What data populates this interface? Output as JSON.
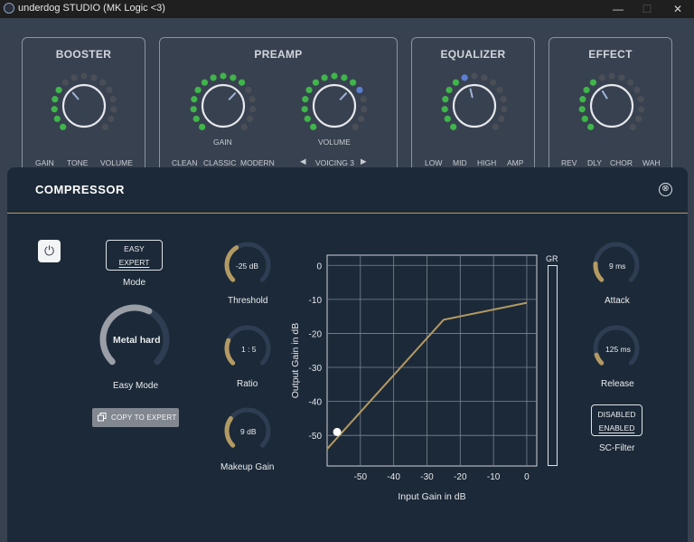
{
  "window": {
    "title": "underdog STUDIO (MK Logic <3)",
    "controls": {
      "minimize": "—",
      "maximize": "☐",
      "close": "✕"
    }
  },
  "modules": {
    "booster": {
      "title": "BOOSTER",
      "options": [
        "GAIN",
        "TONE",
        "VOLUME"
      ],
      "knob_level": 0.35
    },
    "preamp": {
      "title": "PREAMP",
      "channels": [
        "CLEAN",
        "CLASSIC",
        "MODERN"
      ],
      "gain_label": "GAIN",
      "volume_label": "VOLUME",
      "voicing": "VOICING 3",
      "voicing_prev": "◀",
      "voicing_next": "▶",
      "gain_level": 0.66,
      "volume_level": 0.66
    },
    "equalizer": {
      "title": "EQUALIZER",
      "options": [
        "LOW",
        "MID",
        "HIGH",
        "AMP"
      ],
      "knob_level": 0.45
    },
    "effect": {
      "title": "EFFECT",
      "options": [
        "REV",
        "DLY",
        "CHOR",
        "WAH"
      ],
      "knob_level": 0.38
    }
  },
  "compressor": {
    "title": "COMPRESSOR",
    "close_icon": "⊗",
    "power_icon": "⏻",
    "mode": {
      "options": [
        "EASY",
        "EXPERT"
      ],
      "selected": "EXPERT",
      "label": "Mode"
    },
    "easy_mode": {
      "value": "Metal hard",
      "label": "Easy Mode",
      "level": 0.6
    },
    "copy_button": "COPY TO EXPERT",
    "threshold": {
      "value": "-25 dB",
      "label": "Threshold",
      "level": 0.38
    },
    "ratio": {
      "value": "1 : 5",
      "label": "Ratio",
      "level": 0.25
    },
    "makeup_gain": {
      "value": "9 dB",
      "label": "Makeup Gain",
      "level": 0.3
    },
    "attack": {
      "value": "9 ms",
      "label": "Attack",
      "level": 0.18
    },
    "release": {
      "value": "125 ms",
      "label": "Release",
      "level": 0.1
    },
    "sc_filter": {
      "options": [
        "DISABLED",
        "ENABLED"
      ],
      "selected": "ENABLED",
      "label": "SC-Filter"
    },
    "gr_label": "GR",
    "colors": {
      "accent": "#b39a62",
      "panel": "#1c2938",
      "knob_track": "#2e3d52",
      "led_on": "#3fb54a",
      "led_off": "#4a4f57",
      "led_blue": "#5a7fd0"
    }
  },
  "chart_data": {
    "type": "line",
    "title": "",
    "xlabel": "Input Gain in dB",
    "ylabel": "Output Gain in dB",
    "xlim": [
      -60,
      3
    ],
    "ylim": [
      -59,
      3
    ],
    "xticks": [
      -50,
      -40,
      -30,
      -20,
      -10,
      0
    ],
    "yticks": [
      0,
      -10,
      -20,
      -30,
      -40,
      -50
    ],
    "grid": true,
    "series": [
      {
        "x": [
          -60,
          -25,
          0
        ],
        "y": [
          -54,
          -16,
          -11
        ]
      }
    ],
    "marker": {
      "x": -57,
      "y": -49
    }
  }
}
